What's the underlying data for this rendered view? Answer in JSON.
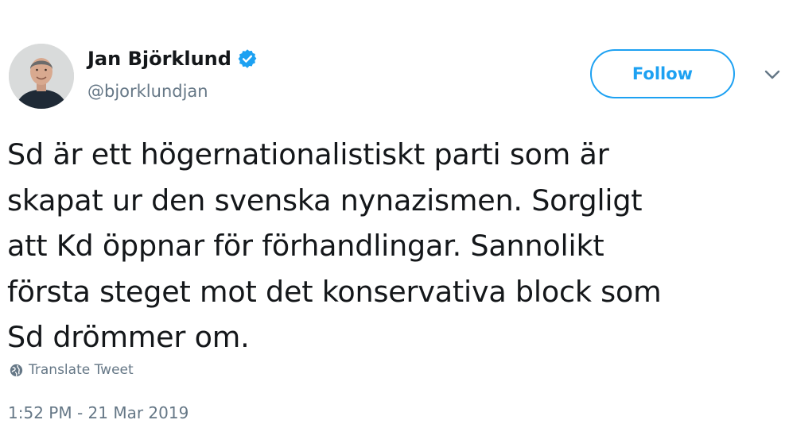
{
  "author": {
    "display_name": "Jan Björklund",
    "handle": "@bjorklundjan",
    "verified": true
  },
  "actions": {
    "follow_label": "Follow"
  },
  "tweet": {
    "lines": [
      "Sd är ett högernationalistiskt parti som är",
      "skapat ur den svenska nynazismen. Sorgligt",
      "att Kd öppnar för förhandlingar. Sannolikt",
      "första steget mot det konservativa block som",
      "Sd drömmer om."
    ],
    "translate_label": "Translate Tweet",
    "timestamp": "1:52 PM - 21 Mar 2019"
  },
  "icons": {
    "verified": "verified-badge-icon",
    "more": "chevron-down-icon",
    "translate": "globe-icon"
  },
  "colors": {
    "brand_blue": "#1da1f2",
    "text_primary": "#14171a",
    "text_secondary": "#657786"
  }
}
